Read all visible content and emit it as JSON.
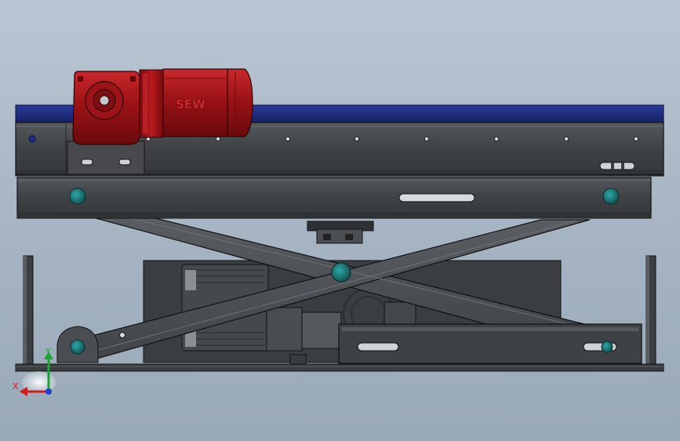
{
  "model": {
    "motor_brand": "SEW",
    "colors": {
      "background_top": "#b9c6d3",
      "background_bottom": "#9aa9b8",
      "frame_dark": "#3a3d40",
      "frame_mid": "#4a4d51",
      "conveyor_belt": "#1d2a78",
      "motor_red": "#8f0f12",
      "motor_red_highlight": "#c21d22",
      "pin_teal": "#1d7f80",
      "outline": "#111213"
    },
    "components": [
      "top-conveyor-frame",
      "lower-platform-beam",
      "scissor-arms",
      "gear-motor",
      "lift-drive-unit",
      "base-frame",
      "guide-posts"
    ]
  },
  "triad": {
    "x_label": "X",
    "y_label": "Y",
    "x_color": "#d11c1c",
    "y_color": "#18a631",
    "z_color": "#1d3fd6"
  }
}
